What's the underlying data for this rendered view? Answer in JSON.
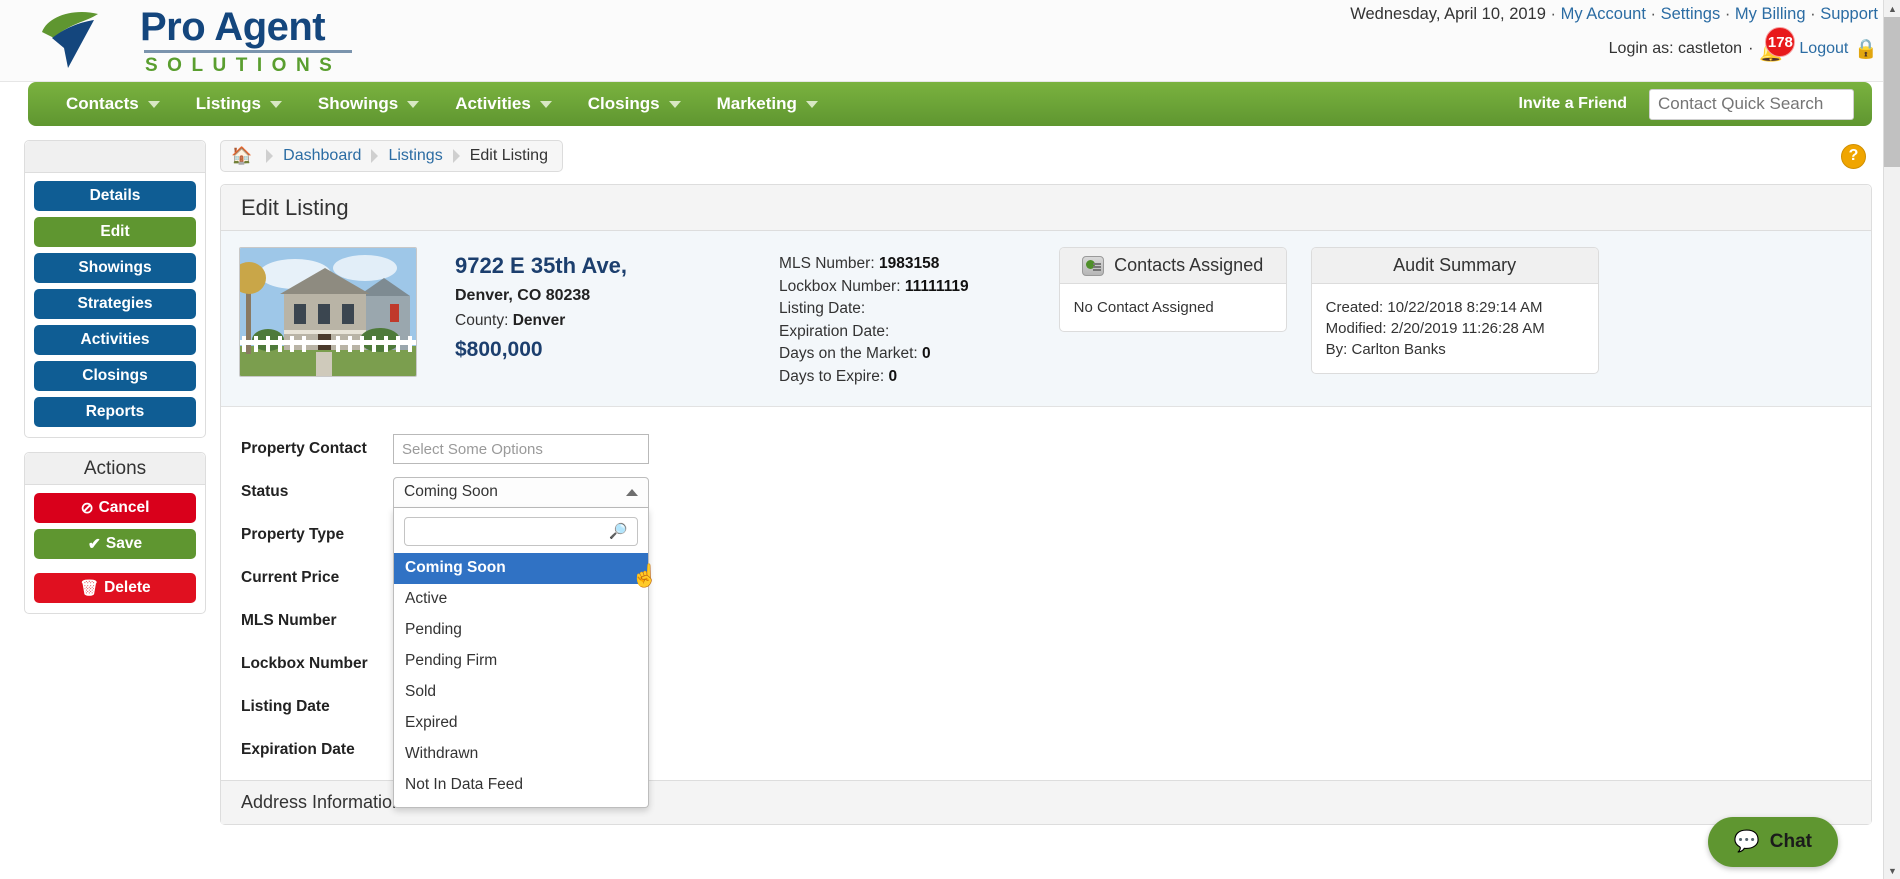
{
  "header": {
    "logo_title": "Pro Agent",
    "logo_sub": "SOLUTIONS",
    "date": "Wednesday, April 10, 2019",
    "links": [
      {
        "label": "My Account"
      },
      {
        "label": "Settings"
      },
      {
        "label": "My Billing"
      },
      {
        "label": "Support"
      }
    ],
    "login_as": "Login as: castleton",
    "notification_count": "178",
    "logout_label": "Logout",
    "bell_icon": "bell-icon",
    "lock_icon": "lock-icon"
  },
  "nav": {
    "items": [
      {
        "label": "Contacts"
      },
      {
        "label": "Listings"
      },
      {
        "label": "Showings"
      },
      {
        "label": "Activities"
      },
      {
        "label": "Closings"
      },
      {
        "label": "Marketing"
      }
    ],
    "invite_label": "Invite a Friend",
    "search_placeholder": "Contact Quick Search"
  },
  "sidebar": {
    "items": [
      {
        "label": "Details",
        "active": false
      },
      {
        "label": "Edit",
        "active": true
      },
      {
        "label": "Showings",
        "active": false
      },
      {
        "label": "Strategies",
        "active": false
      },
      {
        "label": "Activities",
        "active": false
      },
      {
        "label": "Closings",
        "active": false
      },
      {
        "label": "Reports",
        "active": false
      }
    ],
    "actions_title": "Actions",
    "actions": [
      {
        "label": "Cancel",
        "icon": "ban-icon",
        "glyph": "⊘"
      },
      {
        "label": "Save",
        "icon": "check-icon",
        "glyph": "✔"
      },
      {
        "label": "Delete",
        "icon": "trash-icon",
        "glyph": "🗑"
      }
    ]
  },
  "breadcrumb": {
    "home_icon": "home-icon",
    "items": [
      {
        "label": "Dashboard",
        "current": false
      },
      {
        "label": "Listings",
        "current": false
      },
      {
        "label": "Edit Listing",
        "current": true
      }
    ],
    "help_label": "?"
  },
  "main": {
    "card_title": "Edit Listing",
    "property": {
      "address_line1": "9722 E 35th Ave,",
      "address_line2": "Denver, CO 80238",
      "county_label": "County:",
      "county_value": "Denver",
      "price": "$800,000",
      "photo_alt": "property-photo"
    },
    "mls": [
      {
        "label": "MLS Number:",
        "value": "1983158"
      },
      {
        "label": "Lockbox Number:",
        "value": "11111119"
      },
      {
        "label": "Listing Date:",
        "value": ""
      },
      {
        "label": "Expiration Date:",
        "value": ""
      },
      {
        "label": "Days on the Market:",
        "value": "0"
      },
      {
        "label": "Days to Expire:",
        "value": "0"
      }
    ],
    "contacts_panel": {
      "title": "Contacts Assigned",
      "icon": "contact-card-icon",
      "body": "No Contact Assigned"
    },
    "audit_panel": {
      "title": "Audit Summary",
      "created": "Created: 10/22/2018 8:29:14 AM",
      "modified": "Modified: 2/20/2019 11:26:28 AM",
      "by": "By: Carlton Banks"
    },
    "form": {
      "property_contact_label": "Property Contact",
      "property_contact_placeholder": "Select Some Options",
      "status_label": "Status",
      "status_value": "Coming Soon",
      "status_search_value": "",
      "status_options": [
        {
          "label": "Coming Soon",
          "selected": true
        },
        {
          "label": "Active",
          "selected": false
        },
        {
          "label": "Pending",
          "selected": false
        },
        {
          "label": "Pending Firm",
          "selected": false
        },
        {
          "label": "Sold",
          "selected": false
        },
        {
          "label": "Expired",
          "selected": false
        },
        {
          "label": "Withdrawn",
          "selected": false
        },
        {
          "label": "Not In Data Feed",
          "selected": false
        }
      ],
      "property_type_label": "Property Type",
      "current_price_label": "Current Price",
      "mls_number_label": "MLS Number",
      "lockbox_number_label": "Lockbox Number",
      "listing_date_label": "Listing Date",
      "expiration_date_label": "Expiration Date"
    },
    "section_address": "Address Information"
  },
  "chat": {
    "label": "Chat",
    "icon": "chat-bubble-icon"
  },
  "colors": {
    "brand_green": "#5f9630",
    "brand_blue": "#14467d",
    "sidebar_blue": "#0f5d94",
    "danger_red": "#d9001b",
    "option_highlight": "#3072c4",
    "badge_red": "#e8191b"
  }
}
